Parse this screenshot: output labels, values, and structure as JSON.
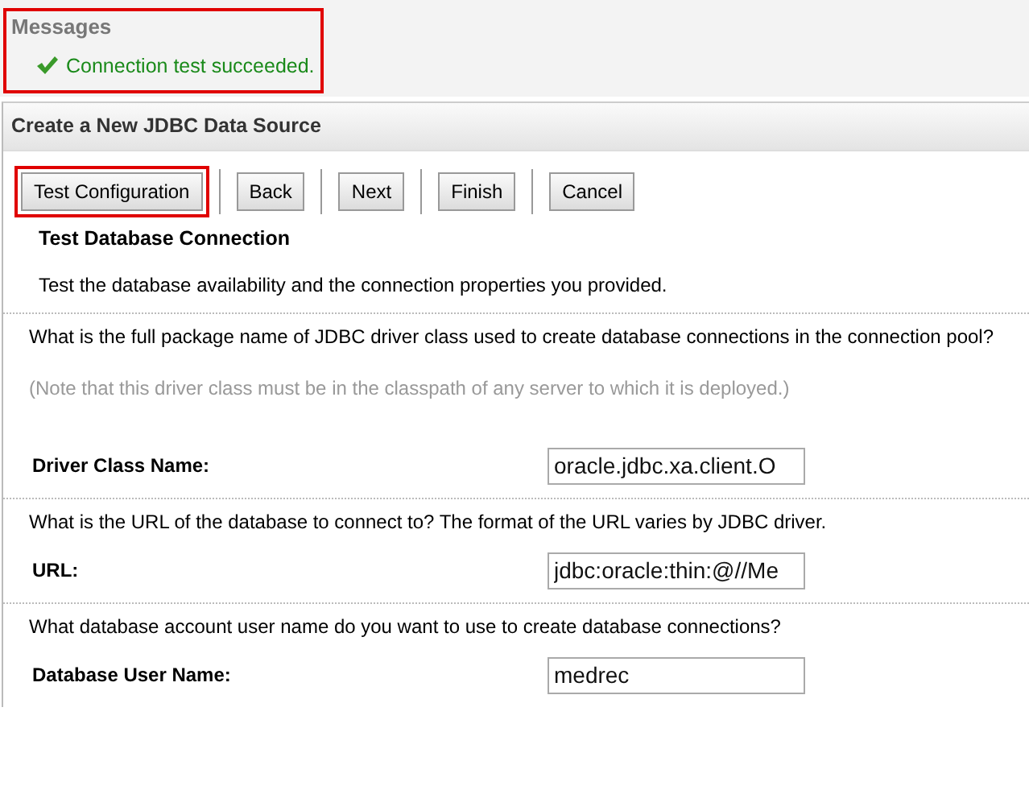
{
  "messages": {
    "title": "Messages",
    "highlighted": true,
    "items": [
      {
        "kind": "success",
        "text": "Connection test succeeded."
      }
    ]
  },
  "panel": {
    "title": "Create a New JDBC Data Source"
  },
  "buttons": [
    {
      "label": "Test Configuration",
      "highlighted": true
    },
    {
      "label": "Back",
      "highlighted": false
    },
    {
      "label": "Next",
      "highlighted": false
    },
    {
      "label": "Finish",
      "highlighted": false
    },
    {
      "label": "Cancel",
      "highlighted": false
    }
  ],
  "section": {
    "title": "Test Database Connection",
    "description": "Test the database availability and the connection properties you provided."
  },
  "fields": [
    {
      "question": "What is the full package name of JDBC driver class used to create database connections in the connection pool?",
      "note": "(Note that this driver class must be in the classpath of any server to which it is deployed.)",
      "label": "Driver Class Name:",
      "value": "oracle.jdbc.xa.client.O"
    },
    {
      "question": "What is the URL of the database to connect to? The format of the URL varies by JDBC driver.",
      "label": "URL:",
      "value": "jdbc:oracle:thin:@//Me"
    },
    {
      "question": "What database account user name do you want to use to create database connections?",
      "label": "Database User Name:",
      "value": "medrec"
    }
  ]
}
